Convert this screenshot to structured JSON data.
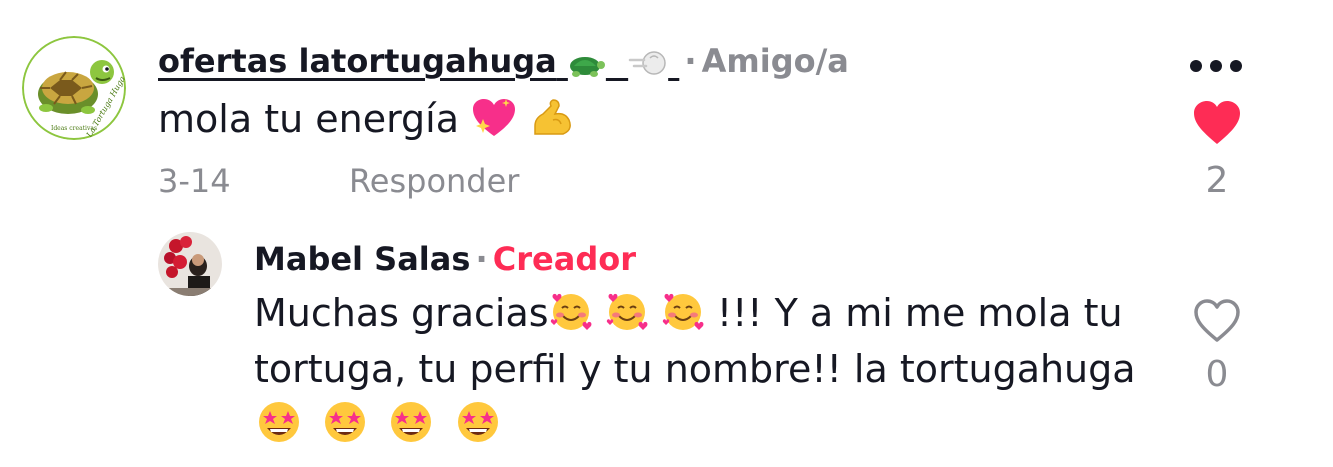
{
  "comment": {
    "username": "ofertas latortugahuga",
    "username_emoji_1": "turtle-emoji",
    "username_emoji_2": "dashing-away-emoji",
    "separator": "·",
    "relation": "Amigo/a",
    "text": "mola tu energía",
    "text_emojis": [
      "sparkling-heart-emoji",
      "flexed-biceps-emoji"
    ],
    "date": "3-14",
    "reply_label": "Responder",
    "like_count": "2",
    "liked": true,
    "avatar_caption": "La Tortuga Huga",
    "avatar_subcaption": "Ideas creativas"
  },
  "reply": {
    "username": "Mabel Salas",
    "separator": "·",
    "badge": "Creador",
    "text_part1": "Muchas gracias",
    "text_emojis_1": [
      "smiling-face-with-hearts-emoji",
      "smiling-face-with-hearts-emoji",
      "smiling-face-with-hearts-emoji"
    ],
    "text_part2": " !!! Y a mi me mola tu",
    "text_line2": "tortuga, tu perfil y tu nombre!! la tortugahuga",
    "text_emojis_2": [
      "star-struck-emoji",
      "star-struck-emoji",
      "star-struck-emoji",
      "star-struck-emoji"
    ],
    "like_count": "0",
    "liked": false
  },
  "colors": {
    "accent_red": "#fe2c55",
    "muted": "#8a8b91",
    "text": "#161823"
  },
  "icons": [
    "more-icon",
    "heart-filled-icon",
    "heart-outline-icon"
  ]
}
